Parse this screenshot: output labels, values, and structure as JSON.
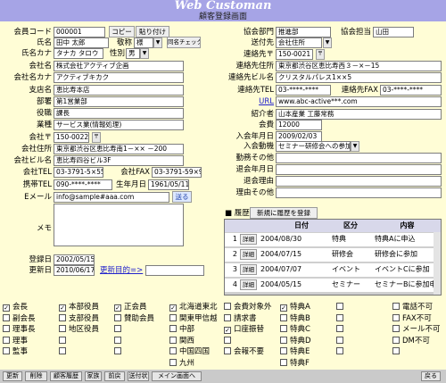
{
  "header": {
    "app_title": "Web Customan",
    "form_title": "顧客登録画面"
  },
  "left": {
    "member_code_label": "会員コード",
    "member_code": "000001",
    "copy_btn": "コピー",
    "paste_btn": "貼り付け",
    "name_label": "氏名",
    "name": "田中 太郎",
    "title_label": "敬称",
    "title": "様",
    "dup_check_btn": "同名チェック",
    "kana_label": "氏名カナ",
    "kana": "タナカ タロウ",
    "gender_label": "性別",
    "gender": "男",
    "company_label": "会社名",
    "company": "株式会社アクティブ企画",
    "company_kana_label": "会社名カナ",
    "company_kana": "アクティブキカク",
    "branch_label": "支店名",
    "branch": "恵比寿本店",
    "dept_label": "部署",
    "dept": "第1営業部",
    "position_label": "役職",
    "position": "課長",
    "industry_label": "業種",
    "industry": "サービス業(情報処理)",
    "company_zip_label": "会社〒",
    "company_zip": "150-0022",
    "company_addr_label": "会社住所",
    "company_addr": "東京都渋谷区恵比寿南1－×× －200",
    "company_bldg_label": "会社ビル名",
    "company_bldg": "恵比寿四谷ビル3F",
    "company_tel_label": "会社TEL",
    "company_tel": "03-3791-5×55",
    "company_fax_label": "会社FAX",
    "company_fax": "03-3791-59×9",
    "mobile_label": "携帯TEL",
    "mobile": "090-****-****",
    "birth_label": "生年月日",
    "birth": "1961/05/11",
    "email_label": "Eメール",
    "email": "info@sample#aaa.com",
    "send_btn": "送る",
    "memo_label": "メモ",
    "registered_label": "登録日",
    "registered": "2002/05/15",
    "updated_label": "更新日",
    "updated": "2010/06/17",
    "renew_link": "更新目的=>"
  },
  "right": {
    "assoc_dept_label": "協会部門",
    "assoc_dept": "推進部",
    "assoc_staff_label": "協会担当",
    "assoc_staff": "山田",
    "send_to_label": "送付先",
    "send_to": "会社住所",
    "contact_zip_label": "連絡先〒",
    "contact_zip": "150-0021",
    "contact_addr_label": "連絡先住所",
    "contact_addr": "東京都渋谷区恵比寿西３－×－15",
    "contact_bldg_label": "連絡先ビル名",
    "contact_bldg": "クリスタルパレス1××5",
    "contact_tel_label": "連絡先TEL",
    "contact_tel": "03-****-****",
    "contact_fax_label": "連絡先FAX",
    "contact_fax": "03-****-****",
    "url_label": "URL",
    "url": "www.abc-active***.com",
    "referrer_label": "紹介者",
    "referrer": "山本産業 工藤常務",
    "fee_label": "会費",
    "fee": "12000",
    "join_date_label": "入会年月日",
    "join_date": "2009/02/03",
    "join_motive_label": "入会動機",
    "join_motive": "セミナー研修会への参加",
    "work_other_label": "勤務その他",
    "withdraw_date_label": "退会年月日",
    "withdraw_reason_label": "退会理由",
    "reason_other_label": "理由その他"
  },
  "history": {
    "title": "履歴",
    "new_btn": "新規に履歴を登録",
    "columns": [
      "日付",
      "区分",
      "内容"
    ],
    "detail_label": "詳細",
    "rows": [
      {
        "no": "1",
        "date": "2004/08/30",
        "cat": "特典",
        "content": "特典Aに申込"
      },
      {
        "no": "2",
        "date": "2004/07/15",
        "cat": "研修会",
        "content": "研修会に参加"
      },
      {
        "no": "3",
        "date": "2004/07/07",
        "cat": "イベント",
        "content": "イベントCに参加"
      },
      {
        "no": "4",
        "date": "2004/05/15",
        "cat": "セミナー",
        "content": "セミナーBに参加申"
      }
    ]
  },
  "checkboxes": [
    [
      {
        "label": "会長",
        "checked": true
      },
      {
        "label": "副会長",
        "checked": false
      },
      {
        "label": "理事長",
        "checked": false
      },
      {
        "label": "理事",
        "checked": false
      },
      {
        "label": "監事",
        "checked": false
      }
    ],
    [
      {
        "label": "本部役員",
        "checked": true
      },
      {
        "label": "支部役員",
        "checked": false
      },
      {
        "label": "地区役員",
        "checked": false
      },
      {
        "label": "",
        "checked": false
      },
      {
        "label": "",
        "checked": false
      }
    ],
    [
      {
        "label": "正会員",
        "checked": true
      },
      {
        "label": "賛助会員",
        "checked": false
      },
      {
        "label": "",
        "checked": false
      },
      {
        "label": "",
        "checked": false
      },
      {
        "label": "",
        "checked": false
      }
    ],
    [
      {
        "label": "北海道東北",
        "checked": true
      },
      {
        "label": "関東甲信越",
        "checked": false
      },
      {
        "label": "中部",
        "checked": false
      },
      {
        "label": "関西",
        "checked": false
      },
      {
        "label": "中国四国",
        "checked": false
      },
      {
        "label": "九州",
        "checked": false
      }
    ],
    [
      {
        "label": "会費対象外",
        "checked": false
      },
      {
        "label": "請求書",
        "checked": false
      },
      {
        "label": "口座振替",
        "checked": true
      },
      {
        "label": "",
        "checked": false
      },
      {
        "label": "会報不要",
        "checked": false
      }
    ],
    [
      {
        "label": "特典A",
        "checked": true
      },
      {
        "label": "特典B",
        "checked": false
      },
      {
        "label": "特典C",
        "checked": false
      },
      {
        "label": "特典D",
        "checked": false
      },
      {
        "label": "特典E",
        "checked": false
      },
      {
        "label": "特典F",
        "checked": false
      }
    ],
    [
      {
        "label": "",
        "checked": false
      },
      {
        "label": "",
        "checked": false
      },
      {
        "label": "",
        "checked": false
      },
      {
        "label": "",
        "checked": false
      },
      {
        "label": "",
        "checked": false
      }
    ],
    [
      {
        "label": "電話不可",
        "checked": false
      },
      {
        "label": "FAX不可",
        "checked": false
      },
      {
        "label": "メール不可",
        "checked": false
      },
      {
        "label": "DM不可",
        "checked": false
      },
      {
        "label": "",
        "checked": false
      }
    ]
  ],
  "bottom": [
    "更新",
    "削除",
    "顧客履歴",
    "家族",
    "前戻",
    "送付状",
    "メイン画面へ",
    "戻る"
  ]
}
